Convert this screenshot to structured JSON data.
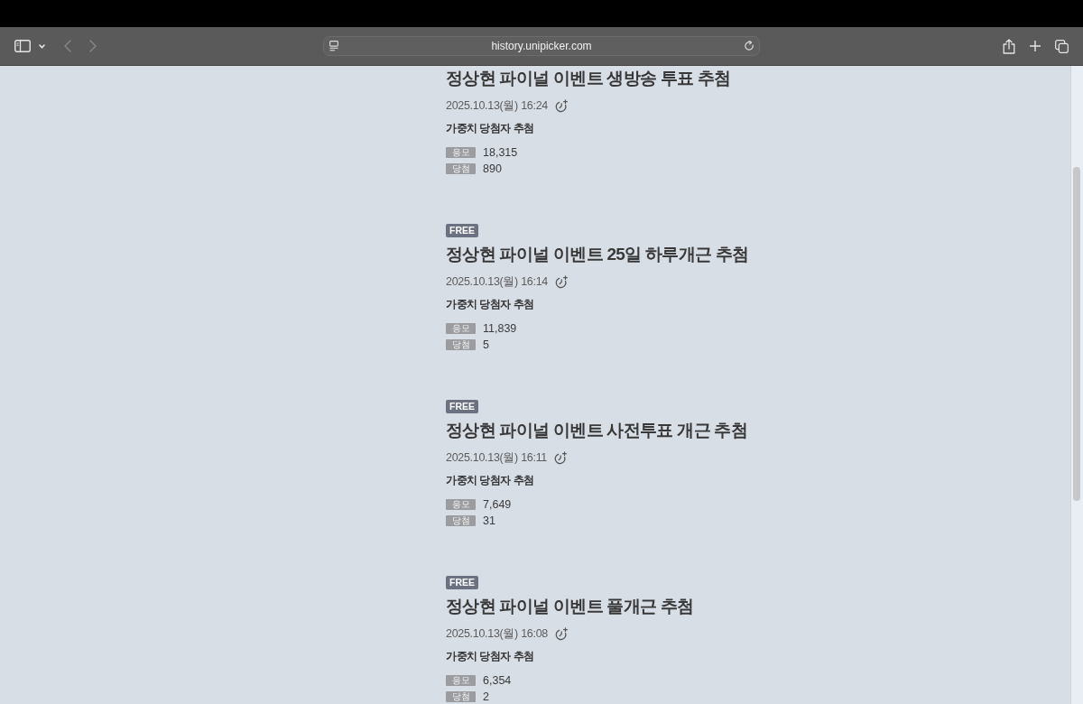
{
  "browser": {
    "back_button": {
      "disabled": true
    },
    "forward_button": {
      "disabled": true
    },
    "address_bar": {
      "url": "history.unipicker.com"
    }
  },
  "draws": [
    {
      "title": "정상현 파이널 이벤트 생방송 투표 추첨",
      "date": "2025.10.13(월) 16:24",
      "method": "가중치 당첨자 추첨",
      "stats": [
        {
          "label": "응모",
          "value": "18,315"
        },
        {
          "label": "당첨",
          "value": "890"
        }
      ]
    },
    {
      "badge": "FREE",
      "title": "정상현 파이널 이벤트 25일 하루개근 추첨",
      "date": "2025.10.13(월) 16:14",
      "method": "가중치 당첨자 추첨",
      "stats": [
        {
          "label": "응모",
          "value": "11,839"
        },
        {
          "label": "당첨",
          "value": "5"
        }
      ]
    },
    {
      "badge": "FREE",
      "title": "정상현 파이널 이벤트 사전투표 개근 추첨",
      "date": "2025.10.13(월) 16:11",
      "method": "가중치 당첨자 추첨",
      "stats": [
        {
          "label": "응모",
          "value": "7,649"
        },
        {
          "label": "당첨",
          "value": "31"
        }
      ]
    },
    {
      "badge": "FREE",
      "title": "정상현 파이널 이벤트 풀개근 추첨",
      "date": "2025.10.13(월) 16:08",
      "method": "가중치 당첨자 추첨",
      "stats": [
        {
          "label": "응모",
          "value": "6,354"
        },
        {
          "label": "당첨",
          "value": "2"
        }
      ]
    }
  ]
}
